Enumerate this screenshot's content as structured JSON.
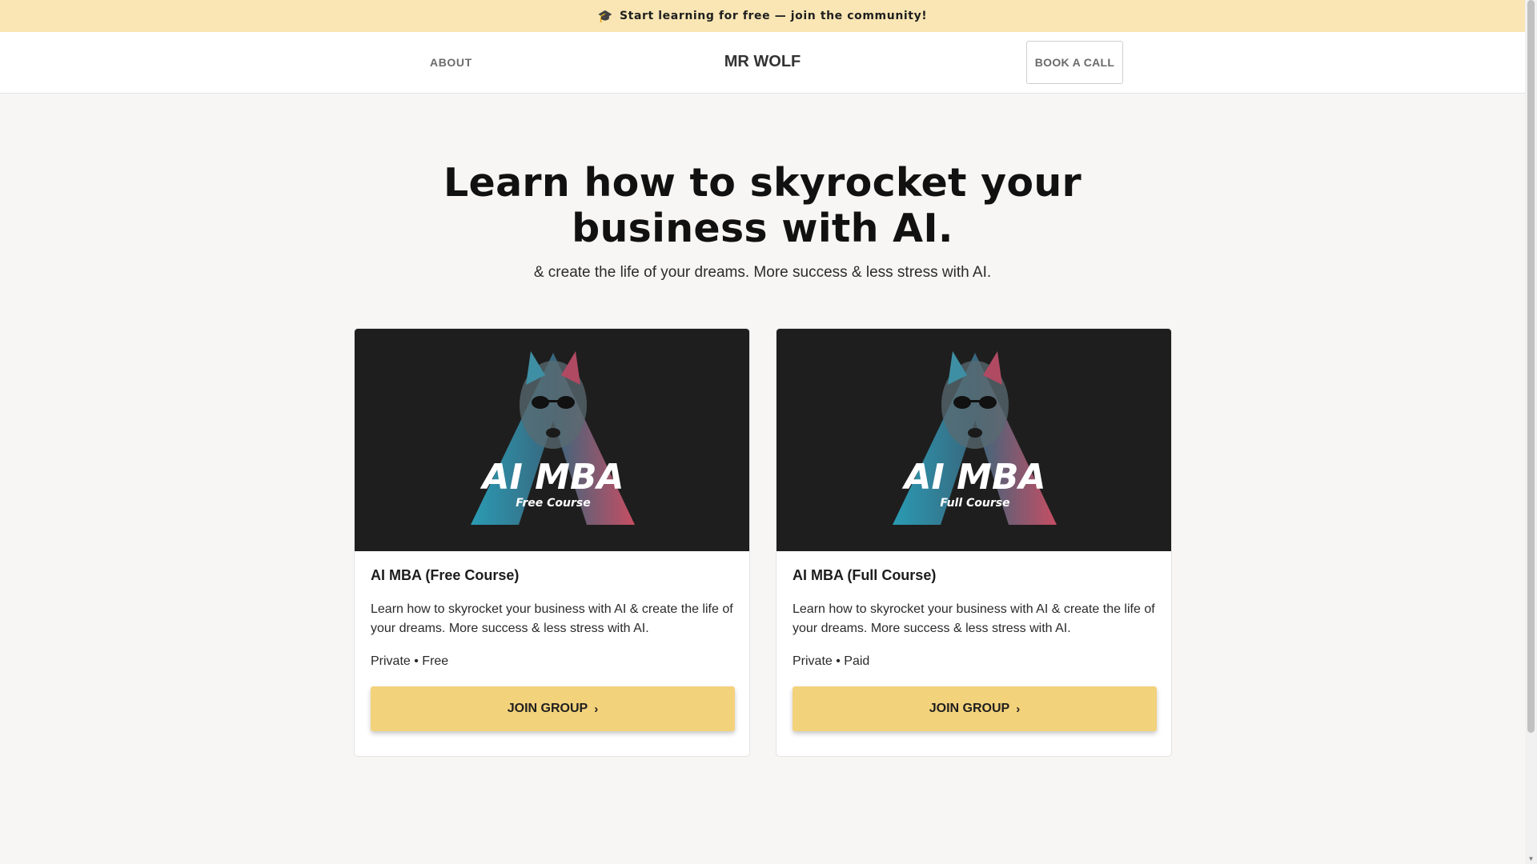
{
  "announcement": {
    "icon": "graduation-cap-icon",
    "text": "Start learning for free — join the community!"
  },
  "header": {
    "about_label": "ABOUT",
    "brand": "MR WOLF",
    "book_call_label": "BOOK A CALL"
  },
  "hero": {
    "title_line1": "Learn how to skyrocket your",
    "title_line2": "business with AI.",
    "subtitle": "& create the life of your dreams. More success & less stress with AI."
  },
  "cards": [
    {
      "image_title": "AI MBA",
      "image_subtitle": "Free Course",
      "title": "AI MBA (Free Course)",
      "description": "Learn how to skyrocket your business with AI & create the life of your dreams. More success & less stress with AI.",
      "meta": "Private • Free",
      "button_label": "JOIN GROUP"
    },
    {
      "image_title": "AI MBA",
      "image_subtitle": "Full Course",
      "title": "AI MBA (Full Course)",
      "description": "Learn how to skyrocket your business with AI & create the life of your dreams. More success & less stress with AI.",
      "meta": "Private • Paid",
      "button_label": "JOIN GROUP"
    }
  ],
  "colors": {
    "announcement_bg": "#f9e6b4",
    "button_bg": "#f3d27c",
    "card_image_bg": "#1f1e1e",
    "accent_teal": "#2ba9c4",
    "accent_pink": "#d9536b"
  }
}
